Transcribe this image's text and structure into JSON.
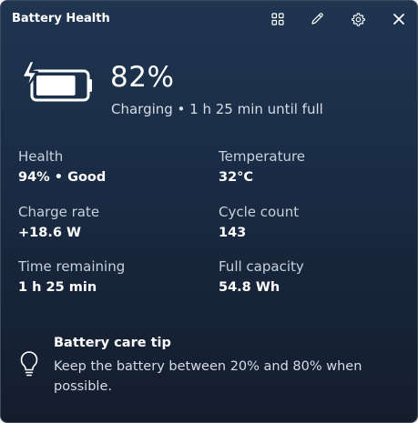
{
  "window": {
    "title": "Battery Health",
    "accent": "#1d3250",
    "toolbar": [
      {
        "icon": "grid-icon"
      },
      {
        "icon": "pen-icon"
      },
      {
        "icon": "gear-icon"
      },
      {
        "icon": "close-icon"
      }
    ]
  },
  "battery": {
    "icon": "battery-charging-icon",
    "percent": "82%",
    "level": 0.82,
    "status": "Charging • 1 h 25 min until full"
  },
  "stats": [
    {
      "label": "Health",
      "value": "94% • Good"
    },
    {
      "label": "Temperature",
      "value": "32°C"
    },
    {
      "label": "Charge rate",
      "value": "+18.6 W"
    },
    {
      "label": "Cycle count",
      "value": "143"
    },
    {
      "label": "Time remaining",
      "value": "1 h 25 min"
    },
    {
      "label": "Full capacity",
      "value": "54.8 Wh"
    }
  ],
  "tip": {
    "icon": "lightbulb-icon",
    "title": "Battery care tip",
    "text": "Keep the battery between 20% and 80% when possible."
  }
}
